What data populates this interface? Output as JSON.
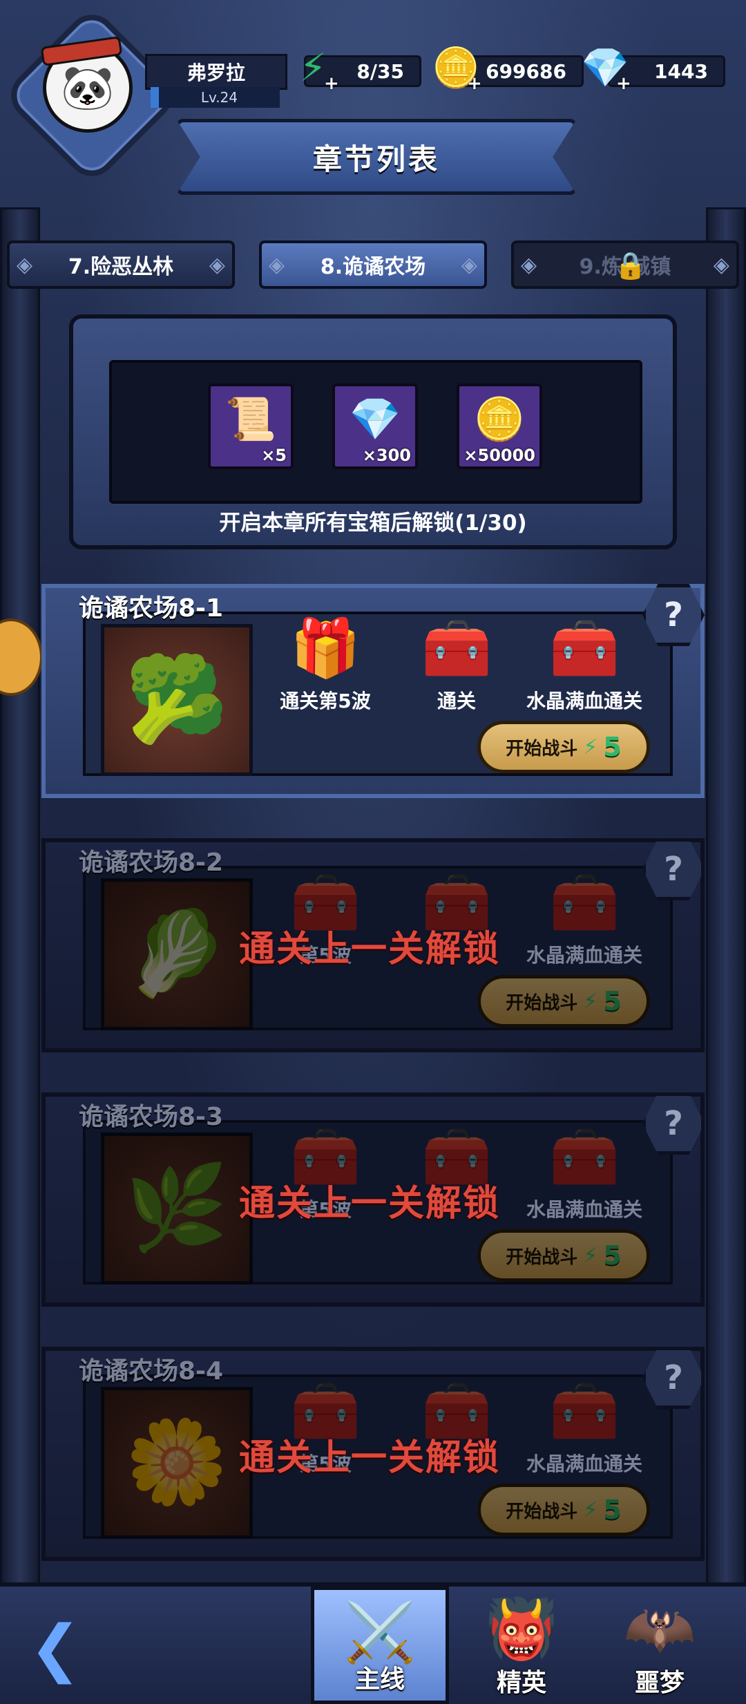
{
  "player": {
    "name": "弗罗拉",
    "level": "Lv.24"
  },
  "resources": {
    "energy": {
      "value": "8/35",
      "icon": "lightning-icon"
    },
    "gold": {
      "value": "699686",
      "icon": "coin-icon"
    },
    "gems": {
      "value": "1443",
      "icon": "diamond-icon"
    }
  },
  "page_title": "章节列表",
  "tabs": [
    {
      "label": "7.险恶丛林",
      "state": "normal"
    },
    {
      "label": "8.诡谲农场",
      "state": "active"
    },
    {
      "label": "9.炼 城镇",
      "state": "locked"
    }
  ],
  "chapter_rewards": {
    "items": [
      {
        "icon": "scroll-icon",
        "qty": "×5"
      },
      {
        "icon": "diamond-icon",
        "qty": "×300"
      },
      {
        "icon": "coin-icon",
        "qty": "×50000"
      }
    ],
    "caption": "开启本章所有宝箱后解锁(1/30)"
  },
  "levels": [
    {
      "title": "诡谲农场8-1",
      "state": "unlocked",
      "chests": [
        "通关第5波",
        "通关",
        "水晶满血通关"
      ],
      "start_label": "开始战斗",
      "cost": "5"
    },
    {
      "title": "诡谲农场8-2",
      "state": "locked",
      "chests": [
        "第5波",
        "",
        "水晶满血通关"
      ],
      "lock_message": "通关上一关解锁",
      "start_label": "开始战斗",
      "cost": "5"
    },
    {
      "title": "诡谲农场8-3",
      "state": "locked",
      "chests": [
        "第5波",
        "",
        "水晶满血通关"
      ],
      "lock_message": "通关上一关解锁",
      "start_label": "开始战斗",
      "cost": "5"
    },
    {
      "title": "诡谲农场8-4",
      "state": "locked",
      "chests": [
        "第5波",
        "",
        "水晶满血通关"
      ],
      "lock_message": "通关上一关解锁",
      "start_label": "开始战斗",
      "cost": "5"
    }
  ],
  "bottom_nav": [
    {
      "label": "主线",
      "active": true
    },
    {
      "label": "精英",
      "active": false
    },
    {
      "label": "噩梦",
      "active": false
    }
  ]
}
